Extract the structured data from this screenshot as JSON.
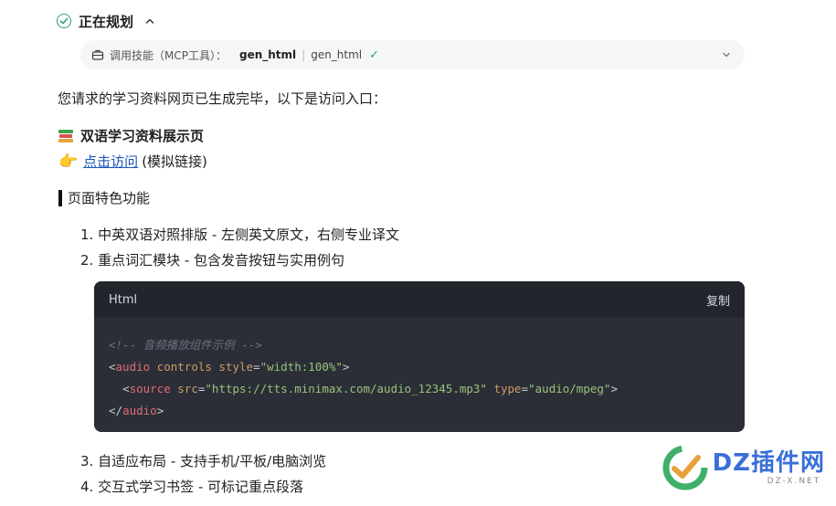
{
  "status": {
    "title": "正在规划"
  },
  "tool_call": {
    "label": "调用技能（MCP工具）：",
    "name_bold": "gen_html",
    "separator": "|",
    "name_plain": "gen_html",
    "status_mark": "✓"
  },
  "intro_text": "您请求的学习资料网页已生成完毕，以下是访问入口：",
  "doc": {
    "title": "双语学习资料展示页",
    "link_text": "点击访问",
    "link_note": "(模拟链接)"
  },
  "section": {
    "heading": "页面特色功能"
  },
  "features": [
    "1. 中英双语对照排版 - 左侧英文原文，右侧专业译文",
    "2. 重点词汇模块 - 包含发音按钮与实用例句",
    "3. 自适应布局 - 支持手机/平板/电脑浏览",
    "4. 交互式学习书签 - 可标记重点段落"
  ],
  "code_block": {
    "language": "Html",
    "copy_label": "复制",
    "comment": "<!-- 音频播放组件示例 -->",
    "line2_open": "<",
    "line2_tag": "audio",
    "line2_attr1": " controls",
    "line2_attr2": " style",
    "line2_eq": "=",
    "line2_val": "\"width:100%\"",
    "line2_close": ">",
    "line3_indent": "  ",
    "line3_open": "<",
    "line3_tag": "source",
    "line3_attr1": " src",
    "line3_eq1": "=",
    "line3_val1": "\"https://tts.minimax.com/audio_12345.mp3\"",
    "line3_attr2": " type",
    "line3_eq2": "=",
    "line3_val2": "\"audio/mpeg\"",
    "line3_close": ">",
    "line4_open": "</",
    "line4_tag": "audio",
    "line4_close": ">"
  },
  "watermark": {
    "title": "DZ插件网",
    "sub": "DZ-X.NET"
  },
  "colors": {
    "accent_green": "#27a26f",
    "link_blue": "#1a56b8",
    "code_bg": "#2b2e37",
    "code_header_bg": "#22252c",
    "watermark_blue": "#3a6fd8"
  }
}
